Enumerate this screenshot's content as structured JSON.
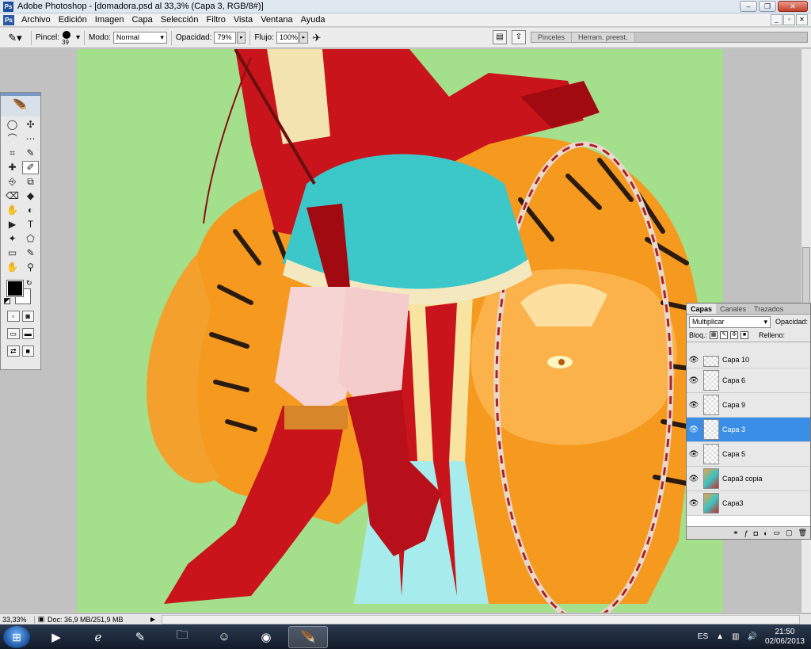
{
  "window": {
    "title": "Adobe Photoshop - [domadora.psd al 33,3% (Capa 3, RGB/8#)]",
    "app_icon": "Ps",
    "buttons": [
      "–",
      "❐",
      "✕"
    ]
  },
  "menu": {
    "items": [
      "Archivo",
      "Edición",
      "Imagen",
      "Capa",
      "Selección",
      "Filtro",
      "Vista",
      "Ventana",
      "Ayuda"
    ],
    "doc_buttons": [
      "_",
      "▫",
      "✕"
    ]
  },
  "options": {
    "brush_label": "Pincel:",
    "brush_size": "39",
    "mode_label": "Modo:",
    "mode_value": "Normal",
    "opacity_label": "Opacidad:",
    "opacity_value": "79%",
    "flow_label": "Flujo:",
    "flow_value": "100%",
    "well_tabs": [
      "Pinceles",
      "Herram. preest."
    ]
  },
  "tools": {
    "icons": [
      "◯",
      "✣",
      "⌒",
      "⋯",
      "⌗",
      "✎",
      "✚",
      "✐",
      "⎆",
      "⧉",
      "⌫",
      "◆",
      "✋",
      "◐",
      "▶",
      "T",
      "✦",
      "⬠",
      "▭",
      "✎",
      "✋",
      "⚲"
    ]
  },
  "layers_panel": {
    "tabs": [
      "Capas",
      "Canales",
      "Trazados"
    ],
    "blend_mode": "Multiplicar",
    "opacity_label": "Opacidad:",
    "lock_label": "Bloq.:",
    "fill_label": "Relleno:",
    "layers": [
      {
        "name": "Capa 10",
        "selected": false,
        "partial": true,
        "art": false
      },
      {
        "name": "Capa 6",
        "selected": false,
        "partial": false,
        "art": false
      },
      {
        "name": "Capa 9",
        "selected": false,
        "partial": false,
        "art": false
      },
      {
        "name": "Capa 3",
        "selected": true,
        "partial": false,
        "art": false
      },
      {
        "name": "Capa 5",
        "selected": false,
        "partial": false,
        "art": false
      },
      {
        "name": "Capa3 copia",
        "selected": false,
        "partial": false,
        "art": true
      },
      {
        "name": "Capa3",
        "selected": false,
        "partial": false,
        "art": true
      }
    ]
  },
  "status": {
    "zoom": "33,33%",
    "doc": "Doc: 36,9 MB/251,9 MB"
  },
  "taskbar": {
    "language": "ES",
    "time": "21:50",
    "date": "02/06/2013"
  },
  "colors": {
    "canvas_bg": "#a4df8c",
    "selected_layer": "#3a8ee6",
    "tiger": "#f59a1f",
    "coat": "#c8141a",
    "skirt": "#3cc7c9"
  }
}
